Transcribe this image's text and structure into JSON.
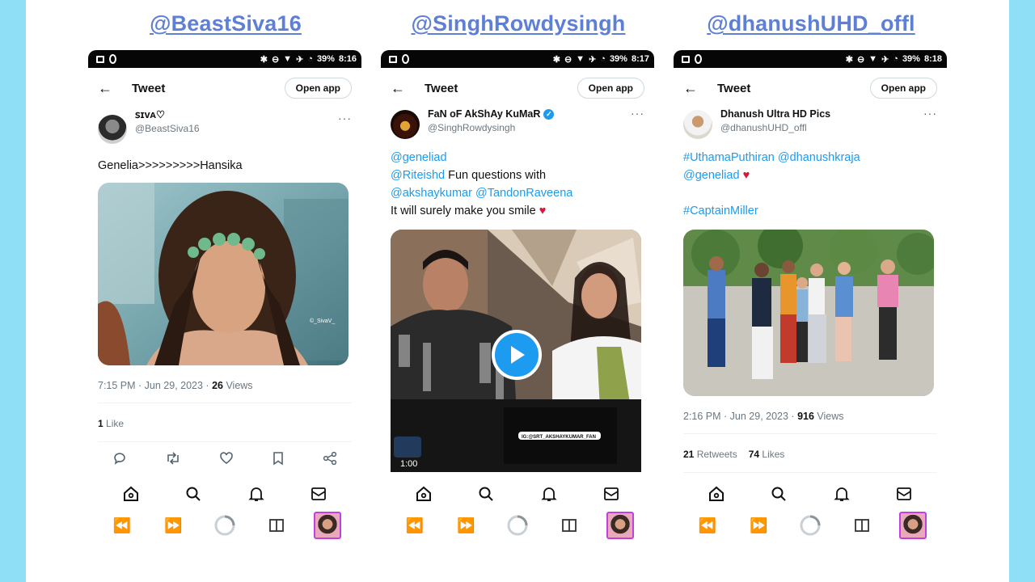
{
  "columns": [
    {
      "title": "@BeastSiva16",
      "status_battery": "39%",
      "status_time": "8:16",
      "header_title": "Tweet",
      "open_app": "Open app",
      "author_name": "ꜱɪᴠᴀ♡",
      "author_handle": "@BeastSiva16",
      "text": "Genelia>>>>>>>>>Hansika",
      "image_watermark": "©_SivaV_",
      "meta_time": "7:15 PM · Jun 29, 2023 · ",
      "meta_views_count": "26",
      "meta_views_label": " Views",
      "likes_count": "1",
      "likes_label": " Like"
    },
    {
      "title": "@SinghRowdysingh",
      "status_battery": "39%",
      "status_time": "8:17",
      "header_title": "Tweet",
      "open_app": "Open app",
      "author_name": "FaN oF AkShAy KuMaR",
      "author_handle": "@SinghRowdysingh",
      "line1_mention": "@geneliad",
      "line2_mention": "@Riteishd",
      "line2_text": " Fun questions with",
      "line3_mention_a": "@akshaykumar",
      "line3_mention_b": "@TandonRaveena",
      "line4_text": "It will surely make you smile ",
      "video_time": "1:00",
      "video_caption": "IG:@SRT_AKSHAYKUMAR_FAN"
    },
    {
      "title": "@dhanushUHD_offl",
      "status_battery": "39%",
      "status_time": "8:18",
      "header_title": "Tweet",
      "open_app": "Open app",
      "author_name": "Dhanush Ultra HD Pics",
      "author_handle": "@dhanushUHD_offl",
      "line1_hashtag": "#UthamaPuthiran",
      "line1_mention": "@dhanushkraja",
      "line2_mention": "@geneliad",
      "line3_hashtag": "#CaptainMiller",
      "meta_time": "2:16 PM · Jun 29, 2023 · ",
      "meta_views_count": "916",
      "meta_views_label": " Views",
      "retweets_count": "21",
      "retweets_label": " Retweets",
      "likes_count": "74",
      "likes_label": " Likes"
    }
  ],
  "colors": {
    "background": "#8fe0f7",
    "title": "#5e7fd6",
    "link": "#1d9bf0"
  },
  "icons": {
    "status_left": [
      "image-icon",
      "circle-icon"
    ],
    "status_right": [
      "bluetooth-icon",
      "do-not-disturb-icon",
      "wifi-icon",
      "airplane-icon",
      "alarm-icon"
    ],
    "tweet_actions": [
      "reply-icon",
      "retweet-icon",
      "like-icon",
      "bookmark-icon",
      "share-icon"
    ],
    "bottom_nav": [
      "home-icon",
      "search-icon",
      "notifications-icon",
      "messages-icon"
    ],
    "system_nav": [
      "rewind-icon",
      "fast-forward-icon",
      "loading-icon",
      "tabs-icon",
      "thumbnail-icon"
    ]
  }
}
